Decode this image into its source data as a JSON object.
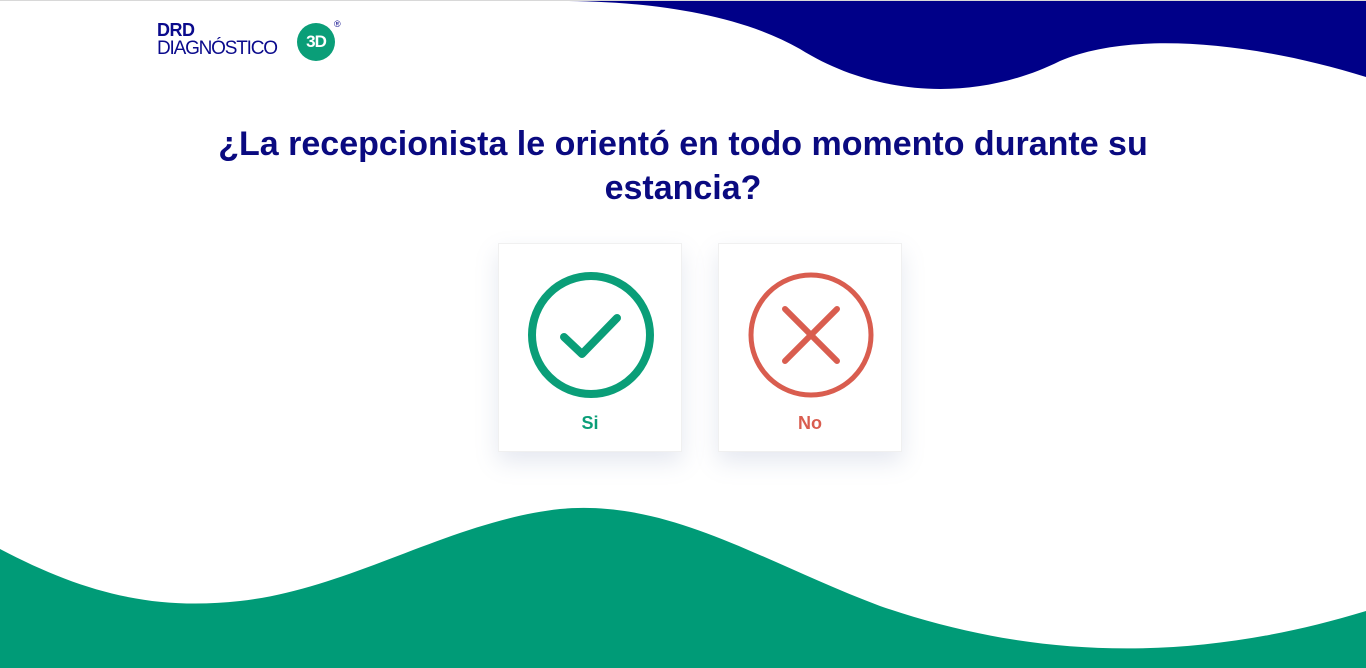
{
  "logo": {
    "line1": "DRD",
    "line2": "DIAGNÓSTICO",
    "badge": "3D",
    "registered": "®"
  },
  "question": "¿La recepcionista le orientó en todo momento durante su estancia?",
  "options": [
    {
      "label": "Si",
      "icon": "check-circle-icon",
      "color": "#0a9e78"
    },
    {
      "label": "No",
      "icon": "x-circle-icon",
      "color": "#d95d4f"
    }
  ],
  "colors": {
    "navy": "#000088",
    "green": "#009b77",
    "question_text": "#0a0a80"
  }
}
